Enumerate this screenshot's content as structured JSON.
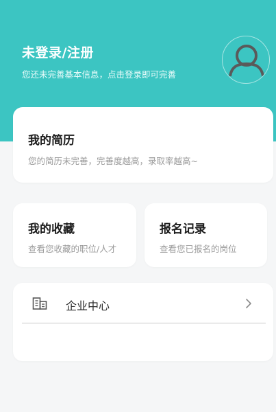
{
  "header": {
    "login_title": "未登录/注册",
    "login_subtitle": "您还未完善基本信息，点击登录即可完善",
    "avatar_icon": "user-avatar-icon"
  },
  "resume_card": {
    "title": "我的简历",
    "description": "您的简历未完善，完善度越高，录取率越高~"
  },
  "favorites_card": {
    "title": "我的收藏",
    "description": "查看您收藏的职位/人才"
  },
  "records_card": {
    "title": "报名记录",
    "description": "查看您已报名的岗位"
  },
  "menu": {
    "items": [
      {
        "label": "企业中心",
        "icon": "building-icon",
        "trailing_icon": "chevron-right-icon"
      }
    ]
  },
  "colors": {
    "header_bg": "#3cc5c2",
    "page_bg": "#f5f6f7",
    "card_bg": "#ffffff"
  }
}
